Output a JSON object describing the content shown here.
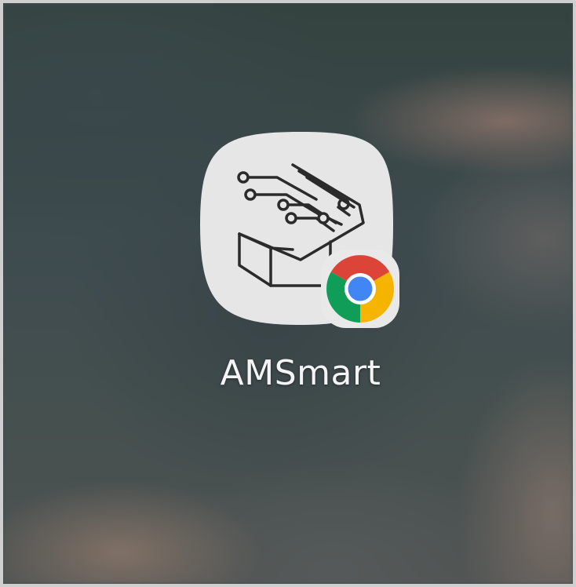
{
  "home_screen": {
    "app": {
      "label": "AMSmart",
      "icon": "circuit-graduation-cap-icon",
      "badge_icon": "chrome-icon"
    }
  },
  "colors": {
    "wallpaper": "#3f4c50",
    "icon_tile": "#e6e6e6",
    "label_text": "#f4f4f4",
    "chrome_red": "#db4437",
    "chrome_yellow": "#f4b400",
    "chrome_green": "#0f9d58",
    "chrome_blue": "#4285f4"
  }
}
